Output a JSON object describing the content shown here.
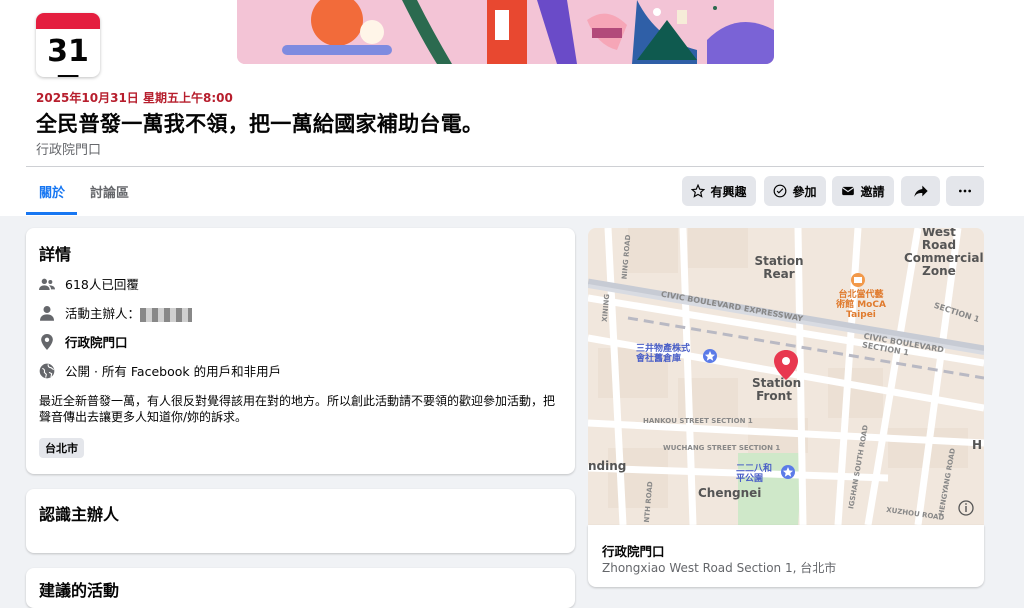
{
  "event": {
    "calendar_day": "31日",
    "datetime": "2025年10月31日 星期五上午8:00",
    "title": "全民普發一萬我不領，把一萬給國家補助台電。",
    "location": "行政院門口"
  },
  "tabs": [
    {
      "label": "關於",
      "active": true
    },
    {
      "label": "討論區",
      "active": false
    }
  ],
  "actions": {
    "interested": "有興趣",
    "going": "參加",
    "invite": "邀請",
    "share_icon": "share-icon",
    "more_icon": "more-icon"
  },
  "details": {
    "heading": "詳情",
    "responded": "618人已回覆",
    "host_label": "活動主辦人：",
    "place": "行政院門口",
    "privacy": "公開 · 所有 Facebook 的用戶和非用戶",
    "description": "最近全新普發一萬，有人很反對覺得該用在對的地方。所以創此活動請不要領的歡迎參加活動，把聲音傳出去讓更多人知道你/妳的訴求。",
    "tag": "台北市"
  },
  "host_card": {
    "heading": "認識主辦人"
  },
  "suggested_card": {
    "heading": "建議的活動"
  },
  "map": {
    "labels": {
      "west_road_1": "West Road",
      "west_road_2": "Commercial",
      "west_road_3": "Zone",
      "station_rear_1": "Station",
      "station_rear_2": "Rear",
      "moca_1": "台北當代藝",
      "moca_2": "術館 MoCA",
      "moca_3": "Taipei",
      "section1": "SECTION 1",
      "civic1": "CIVIC BOULEVARD EXPRESSWAY",
      "civic2": "CIVIC BOULEVARD SECTION 1",
      "mitsui_1": "三井物產株式",
      "mitsui_2": "會社舊倉庫",
      "station_front_1": "Station",
      "station_front_2": "Front",
      "hankou": "HANKOU STREET SECTION 1",
      "wuchang": "WUCHANG STREET SECTION 1",
      "park_1": "二二八和",
      "park_2": "平公園",
      "nding": "nding",
      "chengnei": "Chengnei",
      "h": "H",
      "xuzhou": "XUZHOU ROAD",
      "hengyang": "HENGYANG ROAD",
      "linsen": "IGSHAN SOUTH ROAD",
      "road_left": "NING ROAD",
      "road_left2": "NTH ROAD",
      "xining": "XINING"
    },
    "colors": {
      "pin": "#e8384f",
      "poi": "#5b7be8",
      "museum": "#f2994a",
      "park": "#cfe8c9"
    }
  },
  "map_footer": {
    "name": "行政院門口",
    "address": "Zhongxiao West Road Section 1, 台北市"
  }
}
